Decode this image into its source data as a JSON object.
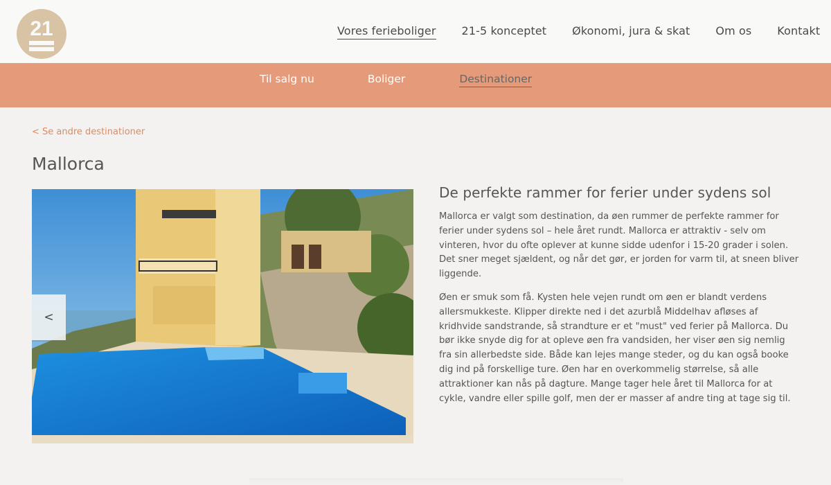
{
  "logo": {
    "text": "21-5",
    "color": "#d9c3a5"
  },
  "main_nav": [
    {
      "label": "Vores ferieboliger",
      "active": true
    },
    {
      "label": "21-5 konceptet",
      "active": false
    },
    {
      "label": "Økonomi, jura & skat",
      "active": false
    },
    {
      "label": "Om os",
      "active": false
    },
    {
      "label": "Kontakt",
      "active": false
    }
  ],
  "sub_nav": [
    {
      "label": "Til salg nu",
      "active": false
    },
    {
      "label": "Boliger",
      "active": false
    },
    {
      "label": "Destinationer",
      "active": true
    }
  ],
  "back_link": "< Se andre destinationer",
  "page_title": "Mallorca",
  "carousel": {
    "prev_label": "<",
    "image": "villa-pool-photo"
  },
  "content": {
    "heading": "De perfekte rammer for ferier under sydens sol",
    "paragraphs": [
      "Mallorca er valgt som destination, da øen rummer de perfekte rammer for ferier under sydens sol – hele året rundt. Mallorca er attraktiv - selv om vinteren, hvor du ofte oplever at kunne sidde udenfor i 15-20 grader i solen. Det sner meget sjældent, og når det gør, er jorden for varm til, at sneen bliver liggende.",
      "Øen er smuk som få. Kysten hele vejen rundt om øen er blandt verdens allersmukkeste. Klipper direkte ned i det azurblå Middelhav afløses af kridhvide sandstrande, så strandture er et \"must\" ved ferier på Mallorca. Du bør ikke snyde dig for at opleve øen fra vandsiden, her viser øen sig nemlig fra sin allerbedste side. Både kan lejes mange steder, og du kan også booke dig ind på forskellige ture. Øen har en overkommelig størrelse, så alle attraktioner kan nås på dagture. Mange tager hele året til Mallorca for at cykle, vandre eller spille golf, men der er masser af andre ting at tage sig til."
    ]
  },
  "colors": {
    "accent": "#e59b79",
    "link": "#e08a60",
    "background": "#f3f2f0"
  }
}
